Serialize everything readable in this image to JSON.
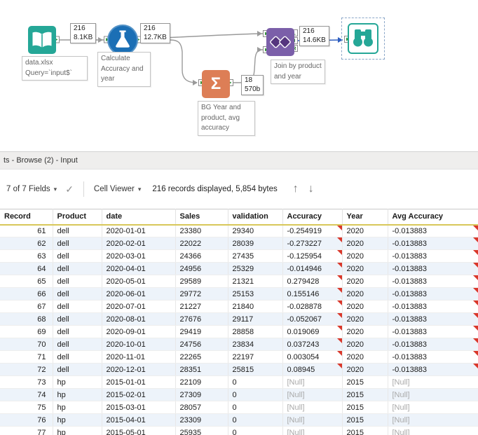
{
  "colors": {
    "input_tool_teal": "#25A797",
    "formula_tool_blue": "#1B6FB5",
    "summarize_tool_orange": "#DD7E56",
    "join_tool_purple": "#7B5FA9",
    "wire_gray": "#9A9A9A",
    "selected_wire_blue": "#2F5FC0",
    "header_underline_gold": "#D8C75A",
    "alt_row_blue": "#EDF3FA",
    "flag_red": "#D9372A",
    "null_text_gray": "#A9A9A9"
  },
  "icons": {
    "check": "✓",
    "caret_down": "▾",
    "up_arrow": "↑",
    "down_arrow": "↓",
    "sigma": "Σ"
  },
  "canvas": {
    "tools": {
      "input": {
        "caption": "data.xlsx\nQuery=`input$`",
        "connection_annotation": "216\n8.1KB"
      },
      "formula": {
        "caption": "Calculate\nAccuracy and\nyear",
        "connection_annotation": "216\n12.7KB"
      },
      "summarize": {
        "caption": "BG Year and\nproduct, avg\naccuracy",
        "connection_annotation": "18\n570b"
      },
      "join": {
        "caption": "Join by product\nand year",
        "connection_annotation": "216\n14.6KB",
        "output_labels": [
          "L",
          "J",
          "R"
        ]
      }
    }
  },
  "results_panel": {
    "title": "ts - Browse (2) - Input",
    "toolbar": {
      "fields_dropdown": "7 of 7 Fields",
      "cell_viewer_dropdown": "Cell Viewer",
      "status_text": "216 records displayed, 5,854 bytes"
    },
    "table": {
      "columns": [
        "Record",
        "Product",
        "date",
        "Sales",
        "validation",
        "Accuracy",
        "Year",
        "Avg Accuracy"
      ],
      "null_text": "[Null]",
      "rows": [
        {
          "record": "61",
          "product": "dell",
          "date": "2020-01-01",
          "sales": "23380",
          "validation": "29340",
          "accuracy": "-0.254919",
          "year": "2020",
          "avg_accuracy": "-0.013883",
          "accuracy_flag": true,
          "avg_accuracy_flag": true
        },
        {
          "record": "62",
          "product": "dell",
          "date": "2020-02-01",
          "sales": "22022",
          "validation": "28039",
          "accuracy": "-0.273227",
          "year": "2020",
          "avg_accuracy": "-0.013883",
          "accuracy_flag": true,
          "avg_accuracy_flag": true
        },
        {
          "record": "63",
          "product": "dell",
          "date": "2020-03-01",
          "sales": "24366",
          "validation": "27435",
          "accuracy": "-0.125954",
          "year": "2020",
          "avg_accuracy": "-0.013883",
          "accuracy_flag": true,
          "avg_accuracy_flag": true
        },
        {
          "record": "64",
          "product": "dell",
          "date": "2020-04-01",
          "sales": "24956",
          "validation": "25329",
          "accuracy": "-0.014946",
          "year": "2020",
          "avg_accuracy": "-0.013883",
          "accuracy_flag": true,
          "avg_accuracy_flag": true
        },
        {
          "record": "65",
          "product": "dell",
          "date": "2020-05-01",
          "sales": "29589",
          "validation": "21321",
          "accuracy": "0.279428",
          "year": "2020",
          "avg_accuracy": "-0.013883",
          "accuracy_flag": true,
          "avg_accuracy_flag": true
        },
        {
          "record": "66",
          "product": "dell",
          "date": "2020-06-01",
          "sales": "29772",
          "validation": "25153",
          "accuracy": "0.155146",
          "year": "2020",
          "avg_accuracy": "-0.013883",
          "accuracy_flag": true,
          "avg_accuracy_flag": true
        },
        {
          "record": "67",
          "product": "dell",
          "date": "2020-07-01",
          "sales": "21227",
          "validation": "21840",
          "accuracy": "-0.028878",
          "year": "2020",
          "avg_accuracy": "-0.013883",
          "accuracy_flag": true,
          "avg_accuracy_flag": true
        },
        {
          "record": "68",
          "product": "dell",
          "date": "2020-08-01",
          "sales": "27676",
          "validation": "29117",
          "accuracy": "-0.052067",
          "year": "2020",
          "avg_accuracy": "-0.013883",
          "accuracy_flag": true,
          "avg_accuracy_flag": true
        },
        {
          "record": "69",
          "product": "dell",
          "date": "2020-09-01",
          "sales": "29419",
          "validation": "28858",
          "accuracy": "0.019069",
          "year": "2020",
          "avg_accuracy": "-0.013883",
          "accuracy_flag": true,
          "avg_accuracy_flag": true
        },
        {
          "record": "70",
          "product": "dell",
          "date": "2020-10-01",
          "sales": "24756",
          "validation": "23834",
          "accuracy": "0.037243",
          "year": "2020",
          "avg_accuracy": "-0.013883",
          "accuracy_flag": true,
          "avg_accuracy_flag": true
        },
        {
          "record": "71",
          "product": "dell",
          "date": "2020-11-01",
          "sales": "22265",
          "validation": "22197",
          "accuracy": "0.003054",
          "year": "2020",
          "avg_accuracy": "-0.013883",
          "accuracy_flag": true,
          "avg_accuracy_flag": true
        },
        {
          "record": "72",
          "product": "dell",
          "date": "2020-12-01",
          "sales": "28351",
          "validation": "25815",
          "accuracy": "0.08945",
          "year": "2020",
          "avg_accuracy": "-0.013883",
          "accuracy_flag": true,
          "avg_accuracy_flag": true
        },
        {
          "record": "73",
          "product": "hp",
          "date": "2015-01-01",
          "sales": "22109",
          "validation": "0",
          "accuracy": "[Null]",
          "year": "2015",
          "avg_accuracy": "[Null]",
          "accuracy_flag": false,
          "avg_accuracy_flag": false
        },
        {
          "record": "74",
          "product": "hp",
          "date": "2015-02-01",
          "sales": "27309",
          "validation": "0",
          "accuracy": "[Null]",
          "year": "2015",
          "avg_accuracy": "[Null]",
          "accuracy_flag": false,
          "avg_accuracy_flag": false
        },
        {
          "record": "75",
          "product": "hp",
          "date": "2015-03-01",
          "sales": "28057",
          "validation": "0",
          "accuracy": "[Null]",
          "year": "2015",
          "avg_accuracy": "[Null]",
          "accuracy_flag": false,
          "avg_accuracy_flag": false
        },
        {
          "record": "76",
          "product": "hp",
          "date": "2015-04-01",
          "sales": "23309",
          "validation": "0",
          "accuracy": "[Null]",
          "year": "2015",
          "avg_accuracy": "[Null]",
          "accuracy_flag": false,
          "avg_accuracy_flag": false
        },
        {
          "record": "77",
          "product": "hp",
          "date": "2015-05-01",
          "sales": "25935",
          "validation": "0",
          "accuracy": "[Null]",
          "year": "2015",
          "avg_accuracy": "[Null]",
          "accuracy_flag": false,
          "avg_accuracy_flag": false
        }
      ]
    }
  }
}
